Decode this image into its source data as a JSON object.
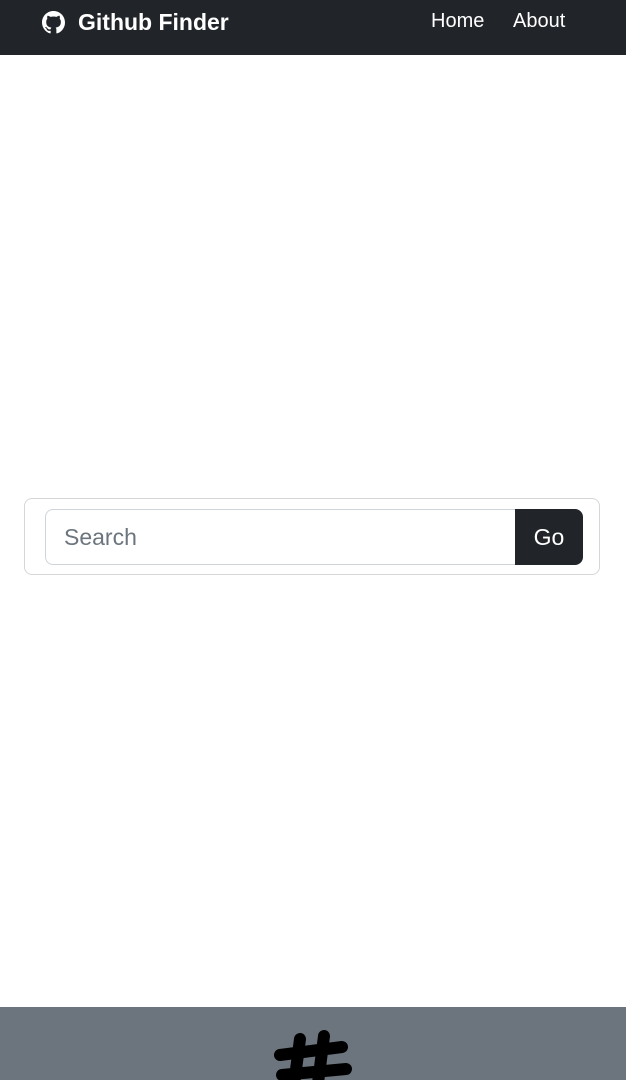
{
  "navbar": {
    "brand_icon": "github-icon",
    "brand_name": "Github Finder",
    "links": [
      {
        "label": "Home"
      },
      {
        "label": "About"
      }
    ],
    "background_color": "#212529"
  },
  "search": {
    "placeholder": "Search",
    "value": "",
    "button_label": "Go"
  },
  "footer": {
    "logo_icon": "slack-hash-logo-icon",
    "background_color": "#6c757d"
  }
}
